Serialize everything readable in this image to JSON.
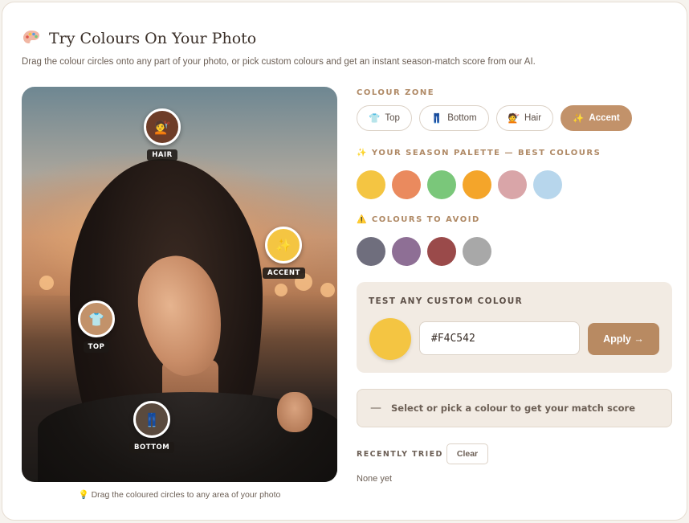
{
  "header": {
    "title": "Try Colours On Your Photo",
    "subtitle": "Drag the colour circles onto any part of your photo, or pick custom colours and get an instant season-match score from our AI.",
    "icon": "artist-palette-icon"
  },
  "photo": {
    "markers": [
      {
        "label": "HAIR",
        "color": "#6e3d28",
        "icon": "hairdresser-icon",
        "glyph": "💇"
      },
      {
        "label": "ACCENT",
        "color": "#f4c542",
        "icon": "sparkles-icon",
        "glyph": "✨"
      },
      {
        "label": "TOP",
        "color": "#c2926a",
        "icon": "t-shirt-icon",
        "glyph": "👕"
      },
      {
        "label": "BOTTOM",
        "color": "#5a4a3e",
        "icon": "jeans-icon",
        "glyph": "👖"
      }
    ],
    "hint": "💡 Drag the coloured circles to any area of your photo"
  },
  "zones": {
    "label": "COLOUR ZONE",
    "items": [
      {
        "label": "Top",
        "icon": "t-shirt-icon",
        "glyph": "👕",
        "active": false
      },
      {
        "label": "Bottom",
        "icon": "jeans-icon",
        "glyph": "👖",
        "active": false
      },
      {
        "label": "Hair",
        "icon": "hairdresser-icon",
        "glyph": "💇",
        "active": false
      },
      {
        "label": "Accent",
        "icon": "sparkles-icon",
        "glyph": "✨",
        "active": true
      }
    ]
  },
  "palette": {
    "label": "✨ YOUR SEASON PALETTE — BEST COLOURS",
    "colors": [
      "#f4c542",
      "#ea8a5e",
      "#7ac77a",
      "#f4a52a",
      "#d9a5a8",
      "#b7d6ec"
    ]
  },
  "avoid": {
    "label": "⚠️ COLOURS TO AVOID",
    "colors": [
      "#6f6e7d",
      "#8e6f95",
      "#9a4a4a",
      "#a8a8a8"
    ]
  },
  "custom": {
    "label": "TEST ANY CUSTOM COLOUR",
    "preview_color": "#f4c542",
    "hex_value": "#F4C542",
    "apply_label": "Apply →"
  },
  "score": {
    "dash": "—",
    "message": "Select or pick a colour to get your match score"
  },
  "recent": {
    "label": "RECENTLY TRIED",
    "clear_label": "Clear",
    "empty_text": "None yet"
  }
}
